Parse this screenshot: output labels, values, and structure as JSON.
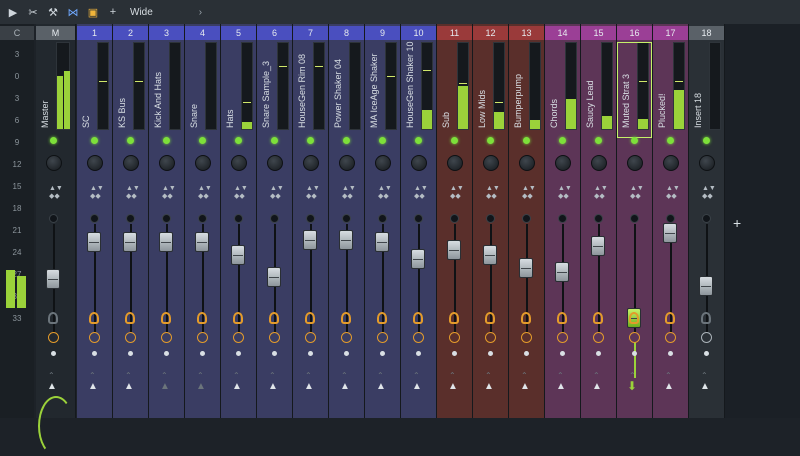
{
  "toolbar": {
    "icons": [
      "play-arrow-icon",
      "scissors-icon",
      "stamp-icon",
      "bowtie-icon",
      "square-icon",
      "plus-icon"
    ],
    "view_label": "Wide",
    "arrow": "›"
  },
  "scale_label": "C",
  "scale_ticks": [
    "3",
    "0",
    "3",
    "6",
    "9",
    "12",
    "15",
    "18",
    "21",
    "24",
    "27",
    "30",
    "33"
  ],
  "master": {
    "header": "M",
    "name": "Master",
    "meter_levels": [
      0.62,
      0.68
    ],
    "fader": 0.62
  },
  "channels": [
    {
      "header": "1",
      "name": "SC",
      "color": "blue",
      "level": 0.0,
      "peak": 0.55,
      "fader": 0.2
    },
    {
      "header": "2",
      "name": "KS Bus",
      "color": "blue",
      "level": 0.0,
      "peak": 0.55,
      "fader": 0.2
    },
    {
      "header": "3",
      "name": "Kick And Hats",
      "color": "blue",
      "level": 0.0,
      "peak": 0.0,
      "fader": 0.2
    },
    {
      "header": "4",
      "name": "Snare",
      "color": "blue",
      "level": 0.0,
      "peak": 0.0,
      "fader": 0.2
    },
    {
      "header": "5",
      "name": "Hats",
      "color": "blue",
      "level": 0.08,
      "peak": 0.3,
      "fader": 0.35
    },
    {
      "header": "6",
      "name": "Snare Sample_3",
      "color": "blue",
      "level": 0.0,
      "peak": 0.72,
      "fader": 0.6
    },
    {
      "header": "7",
      "name": "HouseGen Rim 08",
      "color": "blue",
      "level": 0.0,
      "peak": 0.72,
      "fader": 0.18
    },
    {
      "header": "8",
      "name": "Power Shaker 04",
      "color": "blue",
      "level": 0.0,
      "peak": 0.0,
      "fader": 0.18
    },
    {
      "header": "9",
      "name": "MA IceAge Shaker",
      "color": "blue",
      "level": 0.0,
      "peak": 0.6,
      "fader": 0.2
    },
    {
      "header": "10",
      "name": "HouseGen Shaker 10",
      "color": "blue",
      "level": 0.22,
      "peak": 0.68,
      "fader": 0.4
    },
    {
      "header": "11",
      "name": "Sub",
      "color": "red",
      "level": 0.5,
      "peak": 0.52,
      "fader": 0.3
    },
    {
      "header": "12",
      "name": "Low Mids",
      "color": "red",
      "level": 0.2,
      "peak": 0.3,
      "fader": 0.35
    },
    {
      "header": "13",
      "name": "Bumperpump",
      "color": "red",
      "level": 0.1,
      "peak": 0.0,
      "fader": 0.5
    },
    {
      "header": "14",
      "name": "Chords",
      "color": "pink",
      "level": 0.35,
      "peak": 0.0,
      "fader": 0.55
    },
    {
      "header": "15",
      "name": "Saucy Lead",
      "color": "pink",
      "level": 0.15,
      "peak": 0.0,
      "fader": 0.25
    },
    {
      "header": "16",
      "name": "Muted Strat 3",
      "color": "pink",
      "level": 0.12,
      "peak": 0.55,
      "fader": 0.5,
      "selected": true
    },
    {
      "header": "17",
      "name": "Plucked!",
      "color": "pink",
      "level": 0.45,
      "peak": 0.55,
      "fader": 0.1
    },
    {
      "header": "18",
      "name": "Insert 18",
      "color": "grey",
      "level": 0.0,
      "peak": 0.0,
      "fader": 0.7
    }
  ],
  "colors": {
    "blue_bg": "#3a3d63",
    "red_bg": "#5a2f2b",
    "pink_bg": "#5d3557",
    "grey_bg": "#2a3036",
    "meter": "#9bd23a"
  }
}
